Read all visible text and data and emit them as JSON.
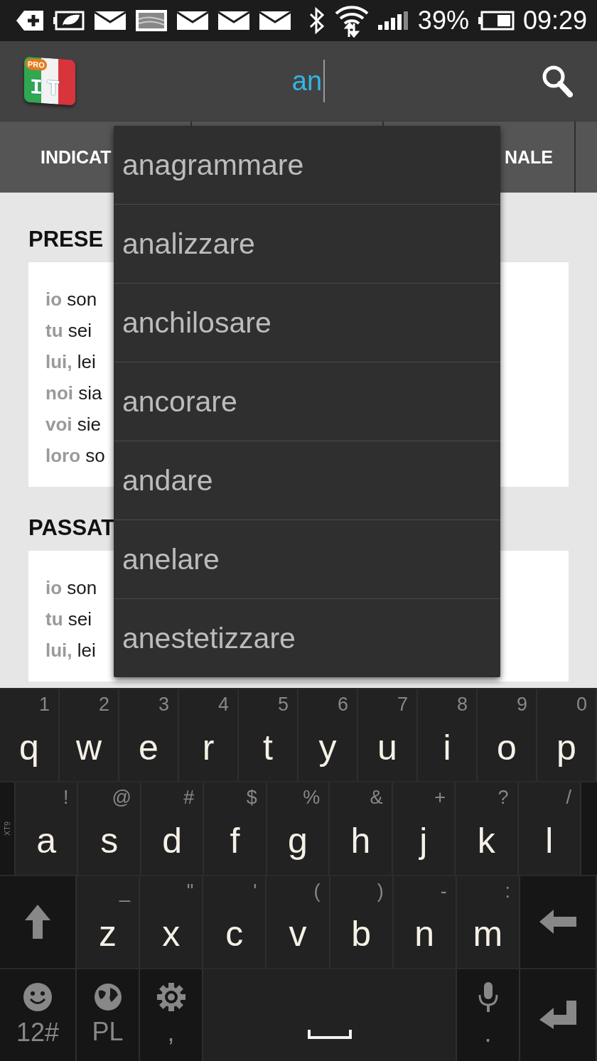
{
  "status_bar": {
    "battery": "39%",
    "time": "09:29"
  },
  "app_bar": {
    "logo_badge": "PRO",
    "logo_text": "IT",
    "search_value": "an"
  },
  "tabs": [
    {
      "label": "INDICAT"
    },
    {
      "label": "NALE"
    }
  ],
  "sections": [
    {
      "heading": "PRESE",
      "rows": [
        {
          "pronoun": "io",
          "verb": "son"
        },
        {
          "pronoun": "tu",
          "verb": "sei"
        },
        {
          "pronoun": "lui,",
          "verb": "lei"
        },
        {
          "pronoun": "noi",
          "verb": "sia"
        },
        {
          "pronoun": "voi",
          "verb": "sie"
        },
        {
          "pronoun": "loro",
          "verb": "so"
        }
      ]
    },
    {
      "heading": "PASSAT",
      "rows": [
        {
          "pronoun": "io",
          "verb": "son"
        },
        {
          "pronoun": "tu",
          "verb": "sei"
        },
        {
          "pronoun": "lui,",
          "verb": "lei"
        }
      ]
    }
  ],
  "suggestions": [
    "anagrammare",
    "analizzare",
    "anchilosare",
    "ancorare",
    "andare",
    "anelare",
    "anestetizzare"
  ],
  "keyboard": {
    "mode_label": "XT9",
    "rows": [
      [
        {
          "kind": "letter",
          "label": "q",
          "alt": "1"
        },
        {
          "kind": "letter",
          "label": "w",
          "alt": "2"
        },
        {
          "kind": "letter",
          "label": "e",
          "alt": "3"
        },
        {
          "kind": "letter",
          "label": "r",
          "alt": "4"
        },
        {
          "kind": "letter",
          "label": "t",
          "alt": "5"
        },
        {
          "kind": "letter",
          "label": "y",
          "alt": "6"
        },
        {
          "kind": "letter",
          "label": "u",
          "alt": "7"
        },
        {
          "kind": "letter",
          "label": "i",
          "alt": "8"
        },
        {
          "kind": "letter",
          "label": "o",
          "alt": "9"
        },
        {
          "kind": "letter",
          "label": "p",
          "alt": "0"
        }
      ],
      [
        {
          "kind": "letter",
          "label": "a",
          "alt": "!"
        },
        {
          "kind": "letter",
          "label": "s",
          "alt": "@"
        },
        {
          "kind": "letter",
          "label": "d",
          "alt": "#"
        },
        {
          "kind": "letter",
          "label": "f",
          "alt": "$"
        },
        {
          "kind": "letter",
          "label": "g",
          "alt": "%"
        },
        {
          "kind": "letter",
          "label": "h",
          "alt": "&"
        },
        {
          "kind": "letter",
          "label": "j",
          "alt": "+"
        },
        {
          "kind": "letter",
          "label": "k",
          "alt": "?"
        },
        {
          "kind": "letter",
          "label": "l",
          "alt": "/"
        }
      ],
      [
        {
          "kind": "shift"
        },
        {
          "kind": "letter",
          "label": "z",
          "alt": "_"
        },
        {
          "kind": "letter",
          "label": "x",
          "alt": "\""
        },
        {
          "kind": "letter",
          "label": "c",
          "alt": "'"
        },
        {
          "kind": "letter",
          "label": "v",
          "alt": "("
        },
        {
          "kind": "letter",
          "label": "b",
          "alt": ")"
        },
        {
          "kind": "letter",
          "label": "n",
          "alt": "-"
        },
        {
          "kind": "letter",
          "label": "m",
          "alt": ":"
        },
        {
          "kind": "backspace"
        }
      ]
    ],
    "function_row": [
      {
        "kind": "emoji",
        "label": "12#"
      },
      {
        "kind": "language",
        "label": "PL"
      },
      {
        "kind": "settings",
        "label": ","
      },
      {
        "kind": "space"
      },
      {
        "kind": "mic",
        "label": "."
      },
      {
        "kind": "enter"
      }
    ]
  }
}
